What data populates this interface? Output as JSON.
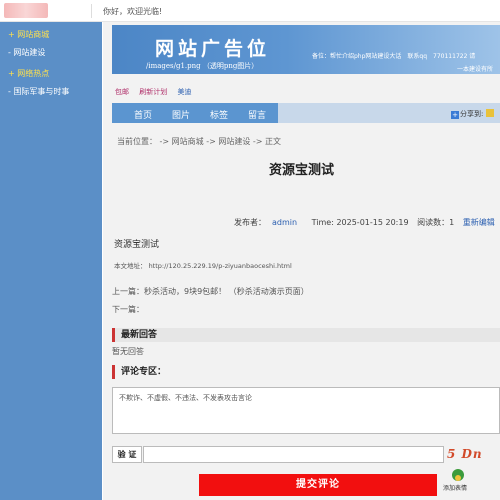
{
  "topbar": {
    "welcome": "你好，欢迎光临!"
  },
  "sidebar": {
    "items": [
      {
        "label": "+ 网站商城"
      },
      {
        "label": "- 网站建设"
      },
      {
        "label": "+ 网络热点"
      },
      {
        "label": "- 国际军事与时事"
      }
    ]
  },
  "banner": {
    "title": "网站广告位",
    "path": "/images/g1.png （透明png图片）",
    "contact": "备位：帮忙介绍php网站建设大话　联系qq　770111722 请",
    "tagline": "一本建设有所"
  },
  "sublinks": [
    "包邮",
    "刷新计划",
    "美迪"
  ],
  "nav": {
    "tabs": [
      "首页",
      "图片",
      "标签",
      "留言"
    ],
    "share": "分享到:"
  },
  "breadcrumb": "当前位置：  -> 网站商城 -> 网站建设 -> 正文",
  "article": {
    "title": "资源宝测试",
    "author_label": "发布者：",
    "author": "admin",
    "time": "Time: 2025-01-15 20:19",
    "views": "阅读数：1",
    "edit_link": "重新编辑",
    "subtitle": "资源宝测试",
    "address": "本文地址： http://120.25.229.19/p-ziyuanbaoceshi.html",
    "prev": "上一篇：秒杀活动，9块9包邮！ （秒杀活动演示页面）",
    "next": "下一篇："
  },
  "replies": {
    "heading": "最新回答",
    "empty": "暂无回答"
  },
  "comments": {
    "heading": "评论专区：",
    "placeholder": "不欺诈、不虚假、不违法、不发表攻击言论",
    "verify_label": "验 证",
    "captcha": "5 Dn",
    "submit": "提交评论",
    "emoji": "添加表情"
  },
  "colors": {
    "sidebar_bg": "#5b8fc7",
    "hot_link": "#ffe14d",
    "nav_active": "#5b95d0",
    "submit_bg": "#f20f0f",
    "section_marker": "#cc3333"
  }
}
